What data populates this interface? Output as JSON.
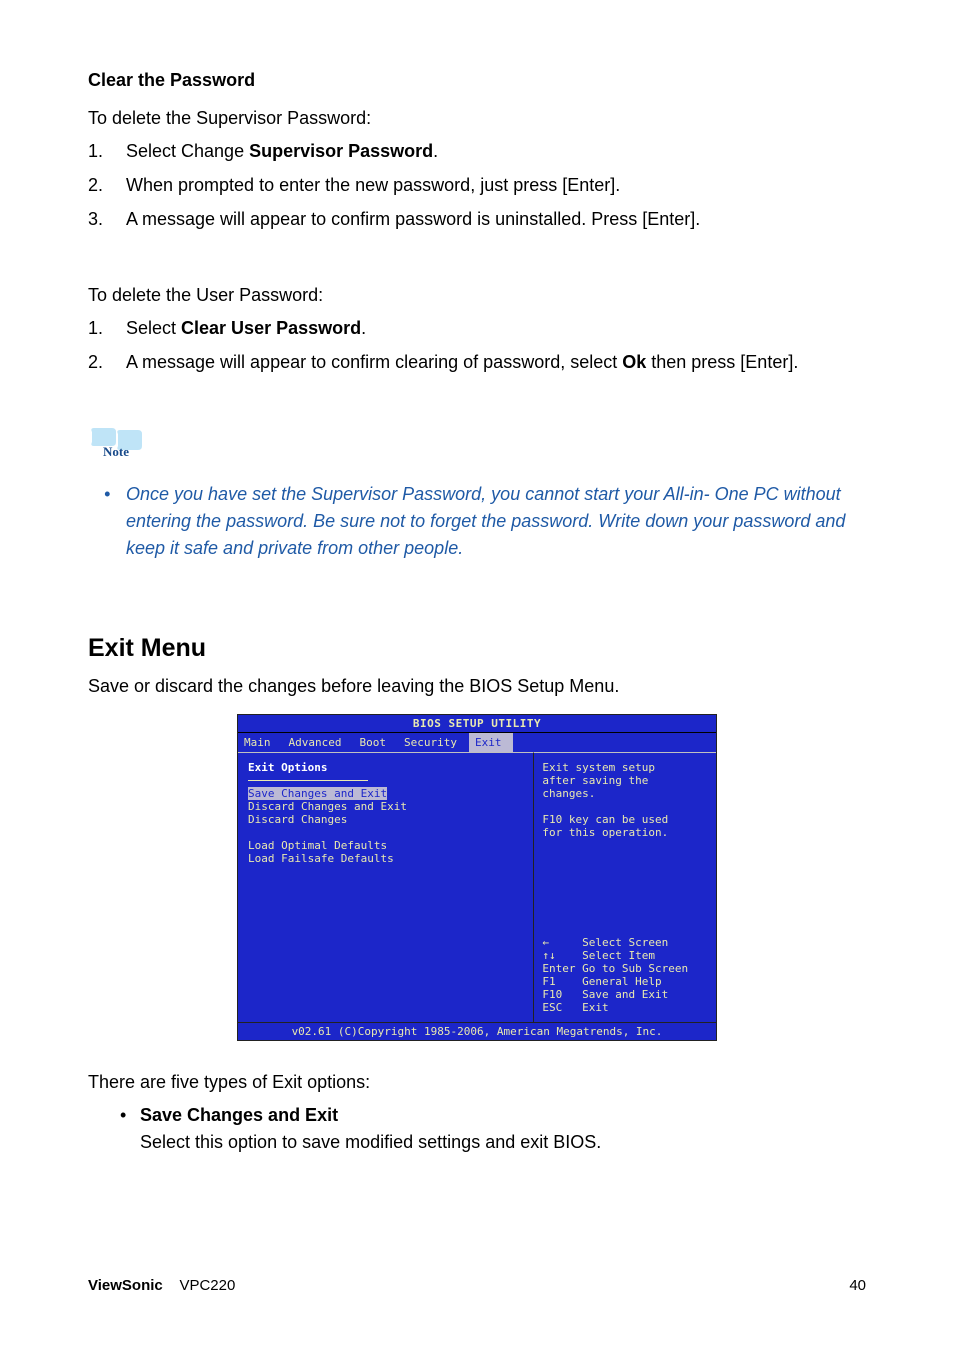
{
  "sections": {
    "clear_pw_title": "Clear the Password",
    "supervisor_intro": "To delete the Supervisor Password:",
    "sup_steps": {
      "s1a": "Select Change ",
      "s1b": "Supervisor Password",
      "s1c": ".",
      "s2": "When prompted to enter the new password, just press [Enter].",
      "s3": "A message will appear to confirm password is uninstalled. Press [Enter]."
    },
    "user_intro": "To delete the User Password:",
    "user_steps": {
      "s1a": "Select ",
      "s1b": "Clear User Password",
      "s1c": ".",
      "s2a": "A message will appear to confirm clearing of password, select ",
      "s2b": "Ok",
      "s2c": " then press [Enter]."
    }
  },
  "note": {
    "label": "Note",
    "text": "Once you have set the Supervisor Password, you cannot start your All-in- One PC without entering the password. Be sure not to forget the password. Write down your password and keep it safe and private from other people."
  },
  "exit": {
    "heading": "Exit Menu",
    "intro": "Save or discard the changes before leaving the BIOS Setup Menu.",
    "outro": "There are five types of Exit options:",
    "opt1_title": "Save Changes and Exit",
    "opt1_desc": "Select this option to save modified settings and exit BIOS."
  },
  "bios": {
    "title": "BIOS SETUP UTILITY",
    "tabs": [
      "Main",
      "Advanced",
      "Boot",
      "Security",
      "Exit"
    ],
    "active_tab_index": 4,
    "left": {
      "heading": "Exit Options",
      "items": [
        "Save Changes and Exit",
        "Discard Changes and Exit",
        "Discard Changes",
        "",
        "Load Optimal Defaults",
        "Load Failsafe Defaults"
      ],
      "active_index": 0
    },
    "right": {
      "help_lines": [
        "Exit system setup",
        "after saving the",
        "changes.",
        "",
        "F10 key can be used",
        "for this operation."
      ],
      "keys": [
        [
          "←",
          "Select Screen"
        ],
        [
          "↑↓",
          "Select Item"
        ],
        [
          "Enter",
          "Go to Sub Screen"
        ],
        [
          "F1",
          "General Help"
        ],
        [
          "F10",
          "Save and Exit"
        ],
        [
          "ESC",
          "Exit"
        ]
      ]
    },
    "copyright": "v02.61 (C)Copyright 1985-2006, American Megatrends, Inc."
  },
  "footer": {
    "brand": "ViewSonic",
    "model": "VPC220",
    "page": "40"
  }
}
